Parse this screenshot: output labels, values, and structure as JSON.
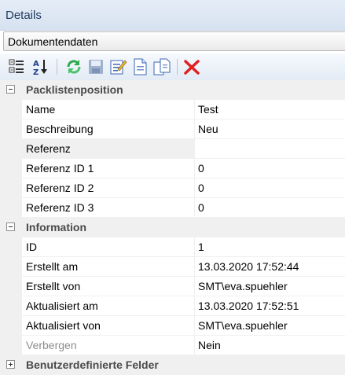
{
  "window": {
    "title": "Details"
  },
  "selector": {
    "value": "Dokumentendaten"
  },
  "toolbar": {
    "buttons": [
      {
        "icon": "categorized-icon"
      },
      {
        "icon": "sort-alphabetical-icon"
      },
      {
        "icon": "refresh-icon"
      },
      {
        "icon": "save-icon"
      },
      {
        "icon": "edit-icon"
      },
      {
        "icon": "new-document-icon"
      },
      {
        "icon": "copy-document-icon"
      },
      {
        "icon": "delete-icon"
      }
    ]
  },
  "categories": [
    {
      "label": "Packlistenposition",
      "expanded": true,
      "properties": [
        {
          "name": "Name",
          "value": "Test"
        },
        {
          "name": "Beschreibung",
          "value": "Neu"
        },
        {
          "name": "Referenz",
          "value": ""
        },
        {
          "name": "Referenz ID 1",
          "value": "0"
        },
        {
          "name": "Referenz ID 2",
          "value": "0"
        },
        {
          "name": "Referenz ID 3",
          "value": "0"
        }
      ]
    },
    {
      "label": "Information",
      "expanded": true,
      "properties": [
        {
          "name": "ID",
          "value": "1"
        },
        {
          "name": "Erstellt am",
          "value": "13.03.2020 17:52:44"
        },
        {
          "name": "Erstellt von",
          "value": "SMT\\eva.spuehler"
        },
        {
          "name": "Aktualisiert am",
          "value": "13.03.2020 17:52:51"
        },
        {
          "name": "Aktualisiert von",
          "value": "SMT\\eva.spuehler"
        },
        {
          "name": "Verbergen",
          "value": "Nein"
        }
      ]
    },
    {
      "label": "Benutzerdefinierte Felder",
      "expanded": false,
      "properties": []
    }
  ],
  "colors": {
    "delete": "#e02020",
    "refresh": "#2fa84f",
    "accent": "#1e395b"
  }
}
